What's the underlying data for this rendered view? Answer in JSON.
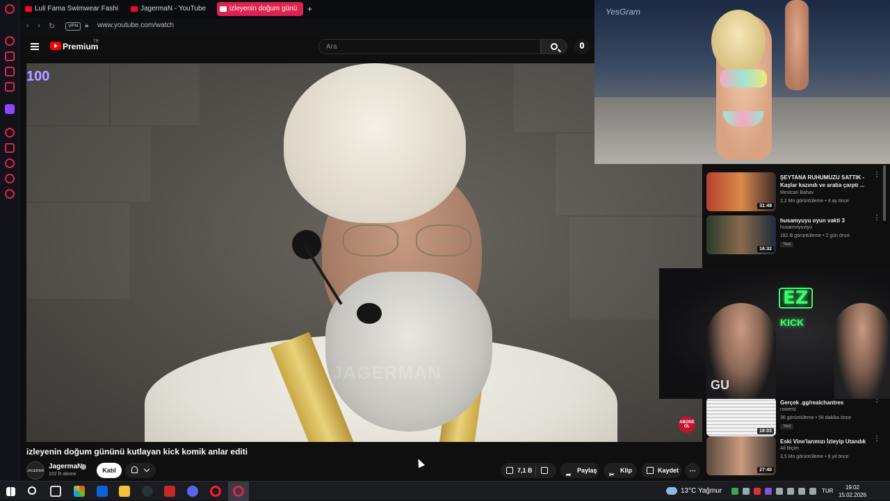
{
  "browser": {
    "tabs": [
      {
        "label": "Luli Fama Swimwear Fashi"
      },
      {
        "label": "JagermaN - YouTube"
      },
      {
        "label": "izleyenin doğum günü"
      }
    ],
    "new_tab_label": "+",
    "vpn_label": "VPN",
    "url": "www.youtube.com/watch"
  },
  "youtube": {
    "logo_text": "Premium",
    "region": "TR",
    "search_placeholder": "Ara"
  },
  "player": {
    "counter_overlay": "100",
    "watermark": "JAGERMAN",
    "abone_badge": "ABONE OL"
  },
  "video": {
    "title": "izleyenin doğum gününü kutlayan kick komik anlar editi",
    "channel_name": "JagermaN",
    "channel_avatar_text": "JAGERMAN",
    "subscribers": "102 B abone",
    "join_label": "Katıl",
    "likes": "7,1 B",
    "share_label": "Paylaş",
    "clip_label": "Klip",
    "save_label": "Kaydet",
    "more_label": "⋯"
  },
  "overlays": {
    "fashion_logo": "YesGram",
    "cam_sign": "EZ",
    "cam_kick": "KICK",
    "shirt_text": "GU"
  },
  "recommendations": [
    {
      "title": "ŞEYTANA RUHUMUZU SATTIK - Kaşlar kazındı ve araba çarptı ...",
      "channel": "Mevtcan Bahav",
      "meta": "2,2 Mn görüntüleme • 4 ay önce",
      "duration": "31:49",
      "badge": ""
    },
    {
      "title": "husamyuyu oyun vakti 3",
      "channel": "husamviyuviyu",
      "meta": "182 B görüntüleme • 2 gün önce",
      "duration": "16:32",
      "badge": "Yeni"
    },
    {
      "title": "Gerçek .gg/realchantres",
      "channel": "rowertz",
      "meta": "36 görüntüleme • 56 dakika önce",
      "duration": "18:03",
      "badge": "Yeni"
    },
    {
      "title": "Eski Vine'larımızı İzleyip Utandık",
      "channel": "Ali Biçim",
      "meta": "3,5 Mn görüntüleme • 6 yıl önce",
      "duration": "27:40",
      "badge": ""
    }
  ],
  "taskbar": {
    "weather": "13°C Yağmur",
    "lang": "TUR",
    "time": "19:02",
    "date": "15.02.2026"
  },
  "colors": {
    "opera_red": "#e0224f",
    "youtube_red": "#ff0000",
    "kick_green": "#39ff6a"
  }
}
